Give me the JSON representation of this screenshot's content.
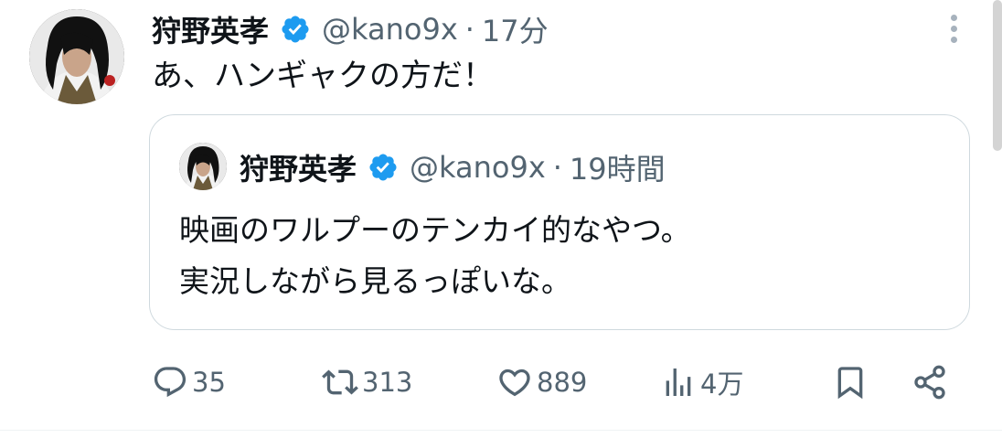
{
  "tweet": {
    "author_name": "狩野英孝",
    "handle": "@kano9x",
    "separator": "·",
    "time": "17分",
    "text": "あ、ハンギャクの方だ！",
    "verified_color": "#1d9bf0"
  },
  "quoted": {
    "author_name": "狩野英孝",
    "handle": "@kano9x",
    "separator": "·",
    "time": "19時間",
    "text_line1": "映画のワルプーのテンカイ的なやつ。",
    "text_line2": "実況しながら見るっぽいな。"
  },
  "actions": {
    "replies": "35",
    "retweets": "313",
    "likes": "889",
    "views": "4万"
  },
  "icons": [
    "more-icon",
    "verified-badge-icon",
    "reply-icon",
    "retweet-icon",
    "like-icon",
    "views-icon",
    "bookmark-icon",
    "share-icon"
  ]
}
